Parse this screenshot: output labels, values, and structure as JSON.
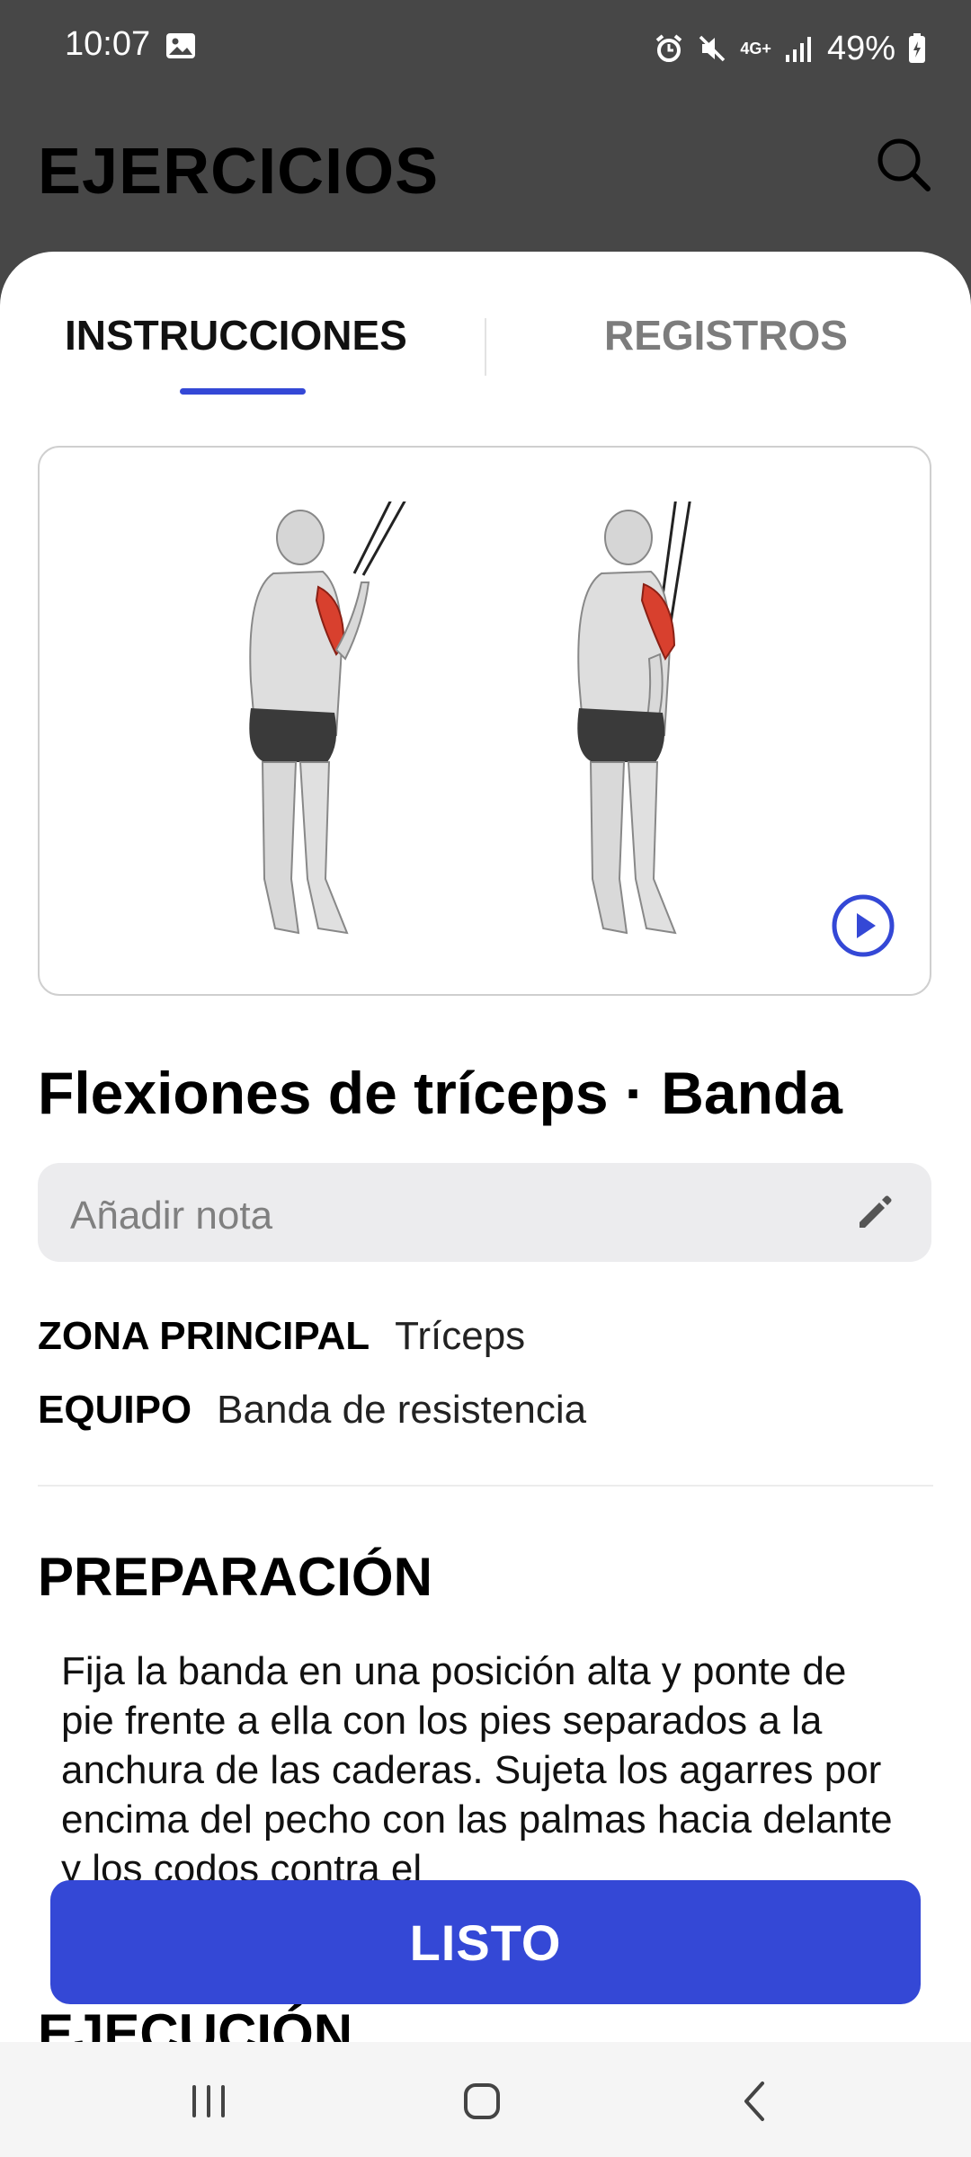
{
  "status_bar": {
    "time": "10:07",
    "network": "4G+",
    "battery": "49%",
    "icons": [
      "image-icon",
      "alarm-icon",
      "mute-icon",
      "signal-icon",
      "battery-icon"
    ]
  },
  "header": {
    "title": "EJERCICIOS",
    "search_icon": "search-icon"
  },
  "tabs": [
    {
      "label": "INSTRUCCIONES",
      "active": true
    },
    {
      "label": "REGISTROS",
      "active": false
    }
  ],
  "media": {
    "play_icon": "play-icon"
  },
  "exercise": {
    "title": "Flexiones de tríceps · Banda",
    "note_placeholder": "Añadir nota",
    "details": [
      {
        "label": "ZONA PRINCIPAL",
        "value": "Tríceps"
      },
      {
        "label": "EQUIPO",
        "value": "Banda de resistencia"
      }
    ],
    "preparation_heading": "PREPARACIÓN",
    "preparation_text": "Fija la banda en una posición alta y ponte de pie frente a ella con los pies separados a la anchura de las caderas. Sujeta los agarres por encima del pecho con las palmas hacia delante y los codos contra el",
    "execution_heading": "EJECUCIÓN"
  },
  "done_button": "LISTO",
  "colors": {
    "accent": "#3448d6",
    "header_bg": "#474747",
    "muscle_highlight": "#d8402e"
  }
}
